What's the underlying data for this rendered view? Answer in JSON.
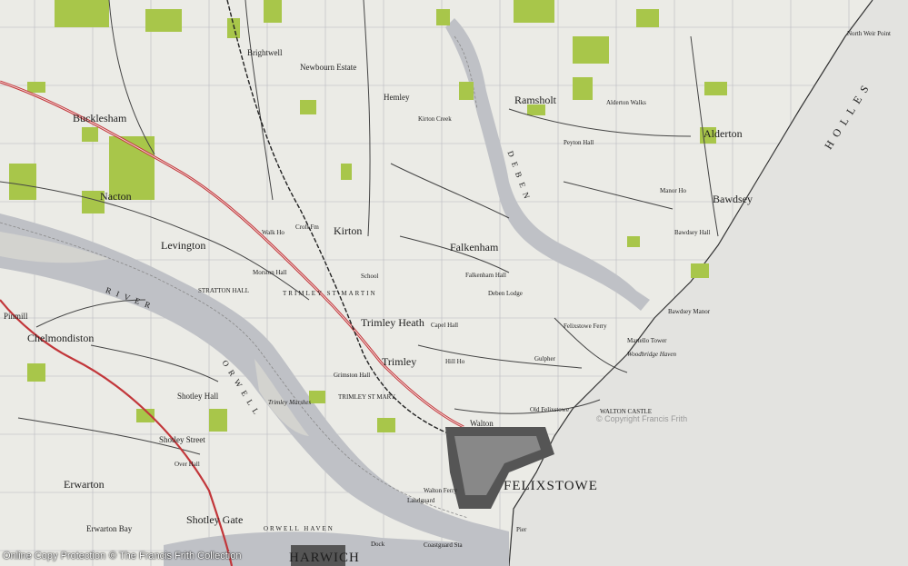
{
  "colors": {
    "paper": "#ebebe6",
    "water": "#bfc1c6",
    "mud": "#dcdcd8",
    "wood": "#a8c64a",
    "road_main": "#c2363a",
    "grid": "#b9b9bf",
    "ink": "#1e1e1e"
  },
  "places": {
    "felixstowe": "FELIXSTOWE",
    "harwich": "HARWICH",
    "kirton": "Kirton",
    "trimley_heath": "Trimley Heath",
    "trimley": "Trimley",
    "bucklesham": "Bucklesham",
    "nacton": "Nacton",
    "levington": "Levington",
    "chelmondiston": "Chelmondiston",
    "shotley_gate": "Shotley Gate",
    "erwarton": "Erwarton",
    "erwarton_bay": "Erwarton Bay",
    "alderton": "Alderton",
    "bawdsey": "Bawdsey",
    "ramsholt": "Ramsholt",
    "falkenham": "Falkenham",
    "hemley": "Hemley",
    "newbourn_estate": "Newbourn Estate",
    "brightwell": "Brightwell",
    "pinmill": "Pinmill",
    "shotley_street": "Shotley Street",
    "walton": "Walton",
    "old_felixstowe": "Old Felixstowe",
    "felixstowe_ferry": "Felixstowe Ferry",
    "woodbridge_haven": "Woodbridge Haven",
    "martello_tower": "Martello Tower",
    "walton_castle": "WALTON CASTLE",
    "bawdsey_manor": "Bawdsey Manor",
    "orwell_haven": "ORWELL HAVEN",
    "trimley_st_martin": "TRIMLEY  ST  MARTIN",
    "trimley_st_mary": "TRIMLEY ST MARY",
    "stratton_hall": "STRATTON HALL",
    "trimley_marshes": "Trimley Marshes",
    "deben_lodge": "Deben Lodge",
    "walton_ferry": "Walton Ferry",
    "landguard": "Landguard",
    "river_orwell": "R I V E R",
    "orwell_word": "O R W E L L",
    "deben": "D E B E N",
    "hollesley": "H O L L E S",
    "kirton_creek": "Kirton Creek",
    "peyton_hall": "Peyton Hall",
    "manor_ho": "Manor Ho",
    "croft_fm": "Croft Fm",
    "hill_ho": "Hill Ho",
    "capel_hall": "Capel Hall",
    "gulpher": "Gulpher",
    "grimston_hall": "Grimston Hall",
    "shotley_hall": "Shotley Hall",
    "over_hall": "Over Hall",
    "pier": "Pier",
    "coastguard_sta": "Coastguard Sta",
    "north_weir_point": "North Weir Point",
    "morston_hall": "Morston Hall",
    "falkenham_hall": "Falkenham Hall",
    "bawdsey_hall": "Bawdsey Hall",
    "alderton_walks": "Alderton Walks",
    "walk_ho": "Walk Ho",
    "school": "School",
    "docks": "Dock"
  },
  "footer": {
    "copyright": "Online Copy Protection",
    "brand": "© The Francis Frith Collection",
    "watermark": "© Copyright Francis Frith"
  }
}
